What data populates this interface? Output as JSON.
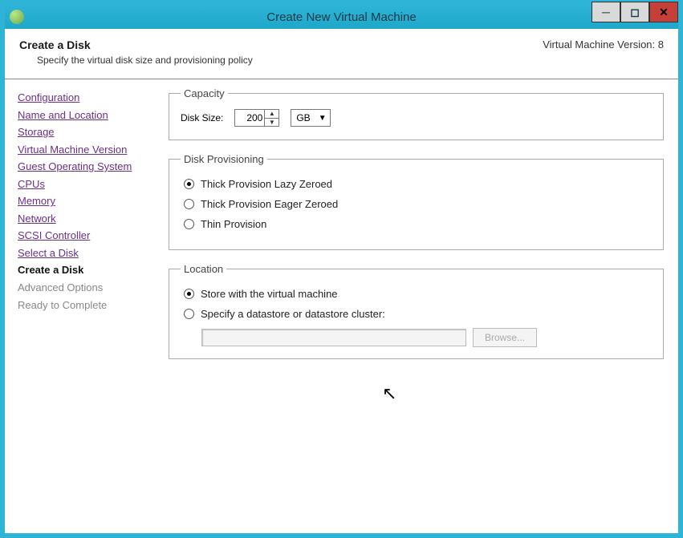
{
  "window": {
    "title": "Create New Virtual Machine"
  },
  "header": {
    "title": "Create a Disk",
    "subtitle": "Specify the virtual disk size and provisioning policy",
    "version_label": "Virtual Machine Version: 8"
  },
  "sidebar": {
    "items": [
      {
        "label": "Configuration",
        "state": "visited"
      },
      {
        "label": "Name and Location",
        "state": "visited"
      },
      {
        "label": "Storage",
        "state": "visited"
      },
      {
        "label": "Virtual Machine Version",
        "state": "visited"
      },
      {
        "label": "Guest Operating System",
        "state": "visited"
      },
      {
        "label": "CPUs",
        "state": "visited"
      },
      {
        "label": "Memory",
        "state": "visited"
      },
      {
        "label": "Network",
        "state": "visited"
      },
      {
        "label": "SCSI Controller",
        "state": "visited"
      },
      {
        "label": "Select a Disk",
        "state": "visited"
      },
      {
        "label": "Create a Disk",
        "state": "current"
      },
      {
        "label": "Advanced Options",
        "state": "future"
      },
      {
        "label": "Ready to Complete",
        "state": "future"
      }
    ]
  },
  "capacity": {
    "legend": "Capacity",
    "label": "Disk Size:",
    "value": "200",
    "unit": "GB"
  },
  "provisioning": {
    "legend": "Disk Provisioning",
    "options": [
      {
        "label": "Thick Provision Lazy Zeroed",
        "selected": true
      },
      {
        "label": "Thick Provision Eager Zeroed",
        "selected": false
      },
      {
        "label": "Thin Provision",
        "selected": false
      }
    ]
  },
  "location": {
    "legend": "Location",
    "options": [
      {
        "label": "Store with the virtual machine",
        "selected": true
      },
      {
        "label": "Specify a datastore or datastore cluster:",
        "selected": false
      }
    ],
    "browse_label": "Browse..."
  }
}
